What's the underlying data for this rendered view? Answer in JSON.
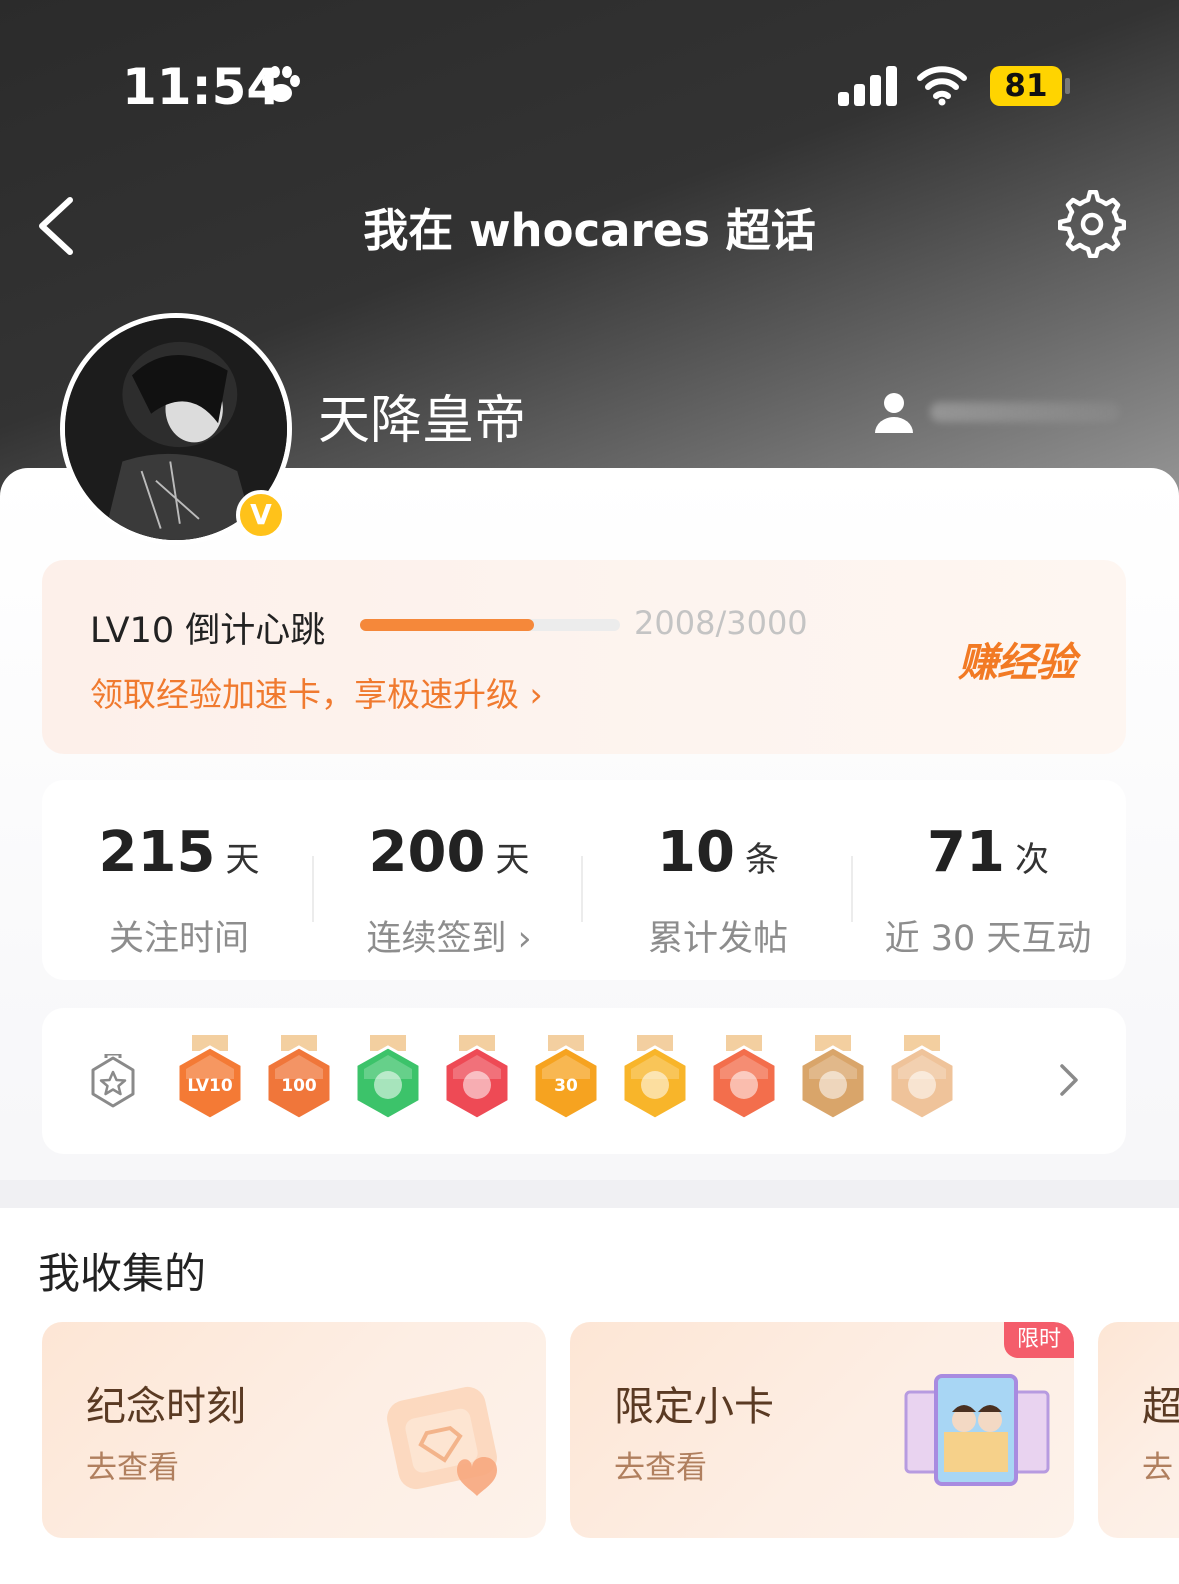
{
  "status_bar": {
    "time": "11:54",
    "battery": "81"
  },
  "nav": {
    "title": "我在 whocares 超话"
  },
  "profile": {
    "username": "天降皇帝",
    "verified_mark": "V"
  },
  "level": {
    "label": "LV10 倒计心跳",
    "progress_text": "2008/3000",
    "progress_fraction": 0.669,
    "promo": "领取经验加速卡，享极速升级 ›",
    "earn_label": "赚经验"
  },
  "stats": [
    {
      "value": "215",
      "unit": "天",
      "label": "关注时间"
    },
    {
      "value": "200",
      "unit": "天",
      "label": "连续签到 ›"
    },
    {
      "value": "10",
      "unit": "条",
      "label": "累计发帖"
    },
    {
      "value": "71",
      "unit": "次",
      "label": "近 30 天互动"
    }
  ],
  "badges": [
    {
      "icon": "lv10-medal-icon",
      "text": "LV10",
      "color": "#f47a35"
    },
    {
      "icon": "100-days-medal-icon",
      "text": "100",
      "color": "#f0763a"
    },
    {
      "icon": "hand-medal-icon",
      "text": "",
      "color": "#3cc36a"
    },
    {
      "icon": "trophy-medal-icon",
      "text": "",
      "color": "#ee4a55"
    },
    {
      "icon": "30-days-medal-icon",
      "text": "30",
      "color": "#f6a320"
    },
    {
      "icon": "laugh-medal-icon",
      "text": "",
      "color": "#f8b52a"
    },
    {
      "icon": "rock-hand-medal-icon",
      "text": "",
      "color": "#f36e4c"
    },
    {
      "icon": "chibi-pair-medal-icon",
      "text": "",
      "color": "#d9a56a"
    },
    {
      "icon": "chibi-lion-medal-icon",
      "text": "",
      "color": "#efc39a"
    }
  ],
  "collection": {
    "title": "我收集的",
    "cards": [
      {
        "title": "纪念时刻",
        "sub": "去查看"
      },
      {
        "title": "限定小卡",
        "sub": "去查看",
        "tag": "限时"
      },
      {
        "title": "超",
        "sub": "去"
      }
    ]
  },
  "colors": {
    "accent": "#f5883a",
    "badge": "#ffc21a",
    "limited": "#f45d6b"
  }
}
